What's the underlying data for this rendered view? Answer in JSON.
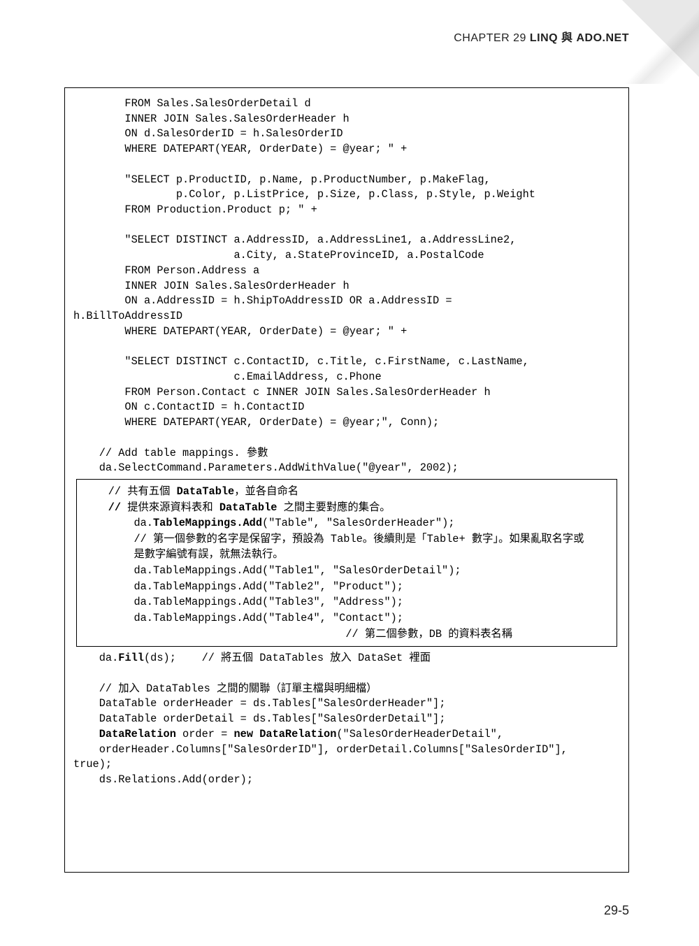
{
  "header": {
    "chapter_label": "CHAPTER 29 ",
    "chapter_title": "LINQ 與 ADO.NET"
  },
  "page_number": "29-5",
  "code": {
    "sql_block": "        FROM Sales.SalesOrderDetail d\n        INNER JOIN Sales.SalesOrderHeader h\n        ON d.SalesOrderID = h.SalesOrderID\n        WHERE DATEPART(YEAR, OrderDate) = @year; \" +\n\n        \"SELECT p.ProductID, p.Name, p.ProductNumber, p.MakeFlag,\n                p.Color, p.ListPrice, p.Size, p.Class, p.Style, p.Weight\n        FROM Production.Product p; \" +\n\n        \"SELECT DISTINCT a.AddressID, a.AddressLine1, a.AddressLine2,\n                         a.City, a.StateProvinceID, a.PostalCode\n        FROM Person.Address a\n        INNER JOIN Sales.SalesOrderHeader h\n        ON a.AddressID = h.ShipToAddressID OR a.AddressID =\nh.BillToAddressID\n        WHERE DATEPART(YEAR, OrderDate) = @year; \" +\n\n        \"SELECT DISTINCT c.ContactID, c.Title, c.FirstName, c.LastName,\n                         c.EmailAddress, c.Phone\n        FROM Person.Contact c INNER JOIN Sales.SalesOrderHeader h\n        ON c.ContactID = h.ContactID\n        WHERE DATEPART(YEAR, OrderDate) = @year;\", Conn);\n\n    // Add table mappings. 參數\n    da.SelectCommand.Parameters.AddWithValue(\"@year\", 2002);",
    "inner_box": {
      "c1_prefix": "    // 共有五個 ",
      "c1_bold": "DataTable",
      "c1_suffix": "，並各自命名",
      "c2_prefix": "    ",
      "c2_bold": "//",
      "c2_mid": " 提供來源資料表和 ",
      "c2_bold2": "DataTable",
      "c2_suffix": " 之間主要對應的集合。",
      "blank": "",
      "m1_prefix": "        da.",
      "m1_bold": "TableMappings.Add",
      "m1_suffix": "(\"Table\", \"SalesOrderHeader\");",
      "m1_comment": "        // 第一個參數的名字是保留字，預設為 Table。後續則是「Table+ 數字」。如果亂取名字或\n        是數字編號有誤，就無法執行。",
      "m2": "        da.TableMappings.Add(\"Table1\", \"SalesOrderDetail\");",
      "m3": "        da.TableMappings.Add(\"Table2\", \"Product\");",
      "m4": "        da.TableMappings.Add(\"Table3\", \"Address\");",
      "m5": "        da.TableMappings.Add(\"Table4\", \"Contact\");",
      "m5_comment": "                                         // 第二個參數，DB 的資料表名稱"
    },
    "after_box": {
      "fill_prefix": "    da.",
      "fill_bold": "Fill",
      "fill_suffix": "(ds);    // 將五個 DataTables 放入 DataSet 裡面",
      "rel_comment": "    // 加入 DataTables 之間的關聯（訂單主檔與明細檔）",
      "rel_1": "    DataTable orderHeader = ds.Tables[\"SalesOrderHeader\"];",
      "rel_2": "    DataTable orderDetail = ds.Tables[\"SalesOrderDetail\"];",
      "rel_3_prefix": "    ",
      "rel_3_bold1": "DataRelation",
      "rel_3_mid": " order = ",
      "rel_3_bold2": "new DataRelation",
      "rel_3_suffix": "(\"SalesOrderHeaderDetail\",",
      "rel_4": "    orderHeader.Columns[\"SalesOrderID\"], orderDetail.Columns[\"SalesOrderID\"],\ntrue);",
      "rel_5": "    ds.Relations.Add(order);"
    }
  }
}
